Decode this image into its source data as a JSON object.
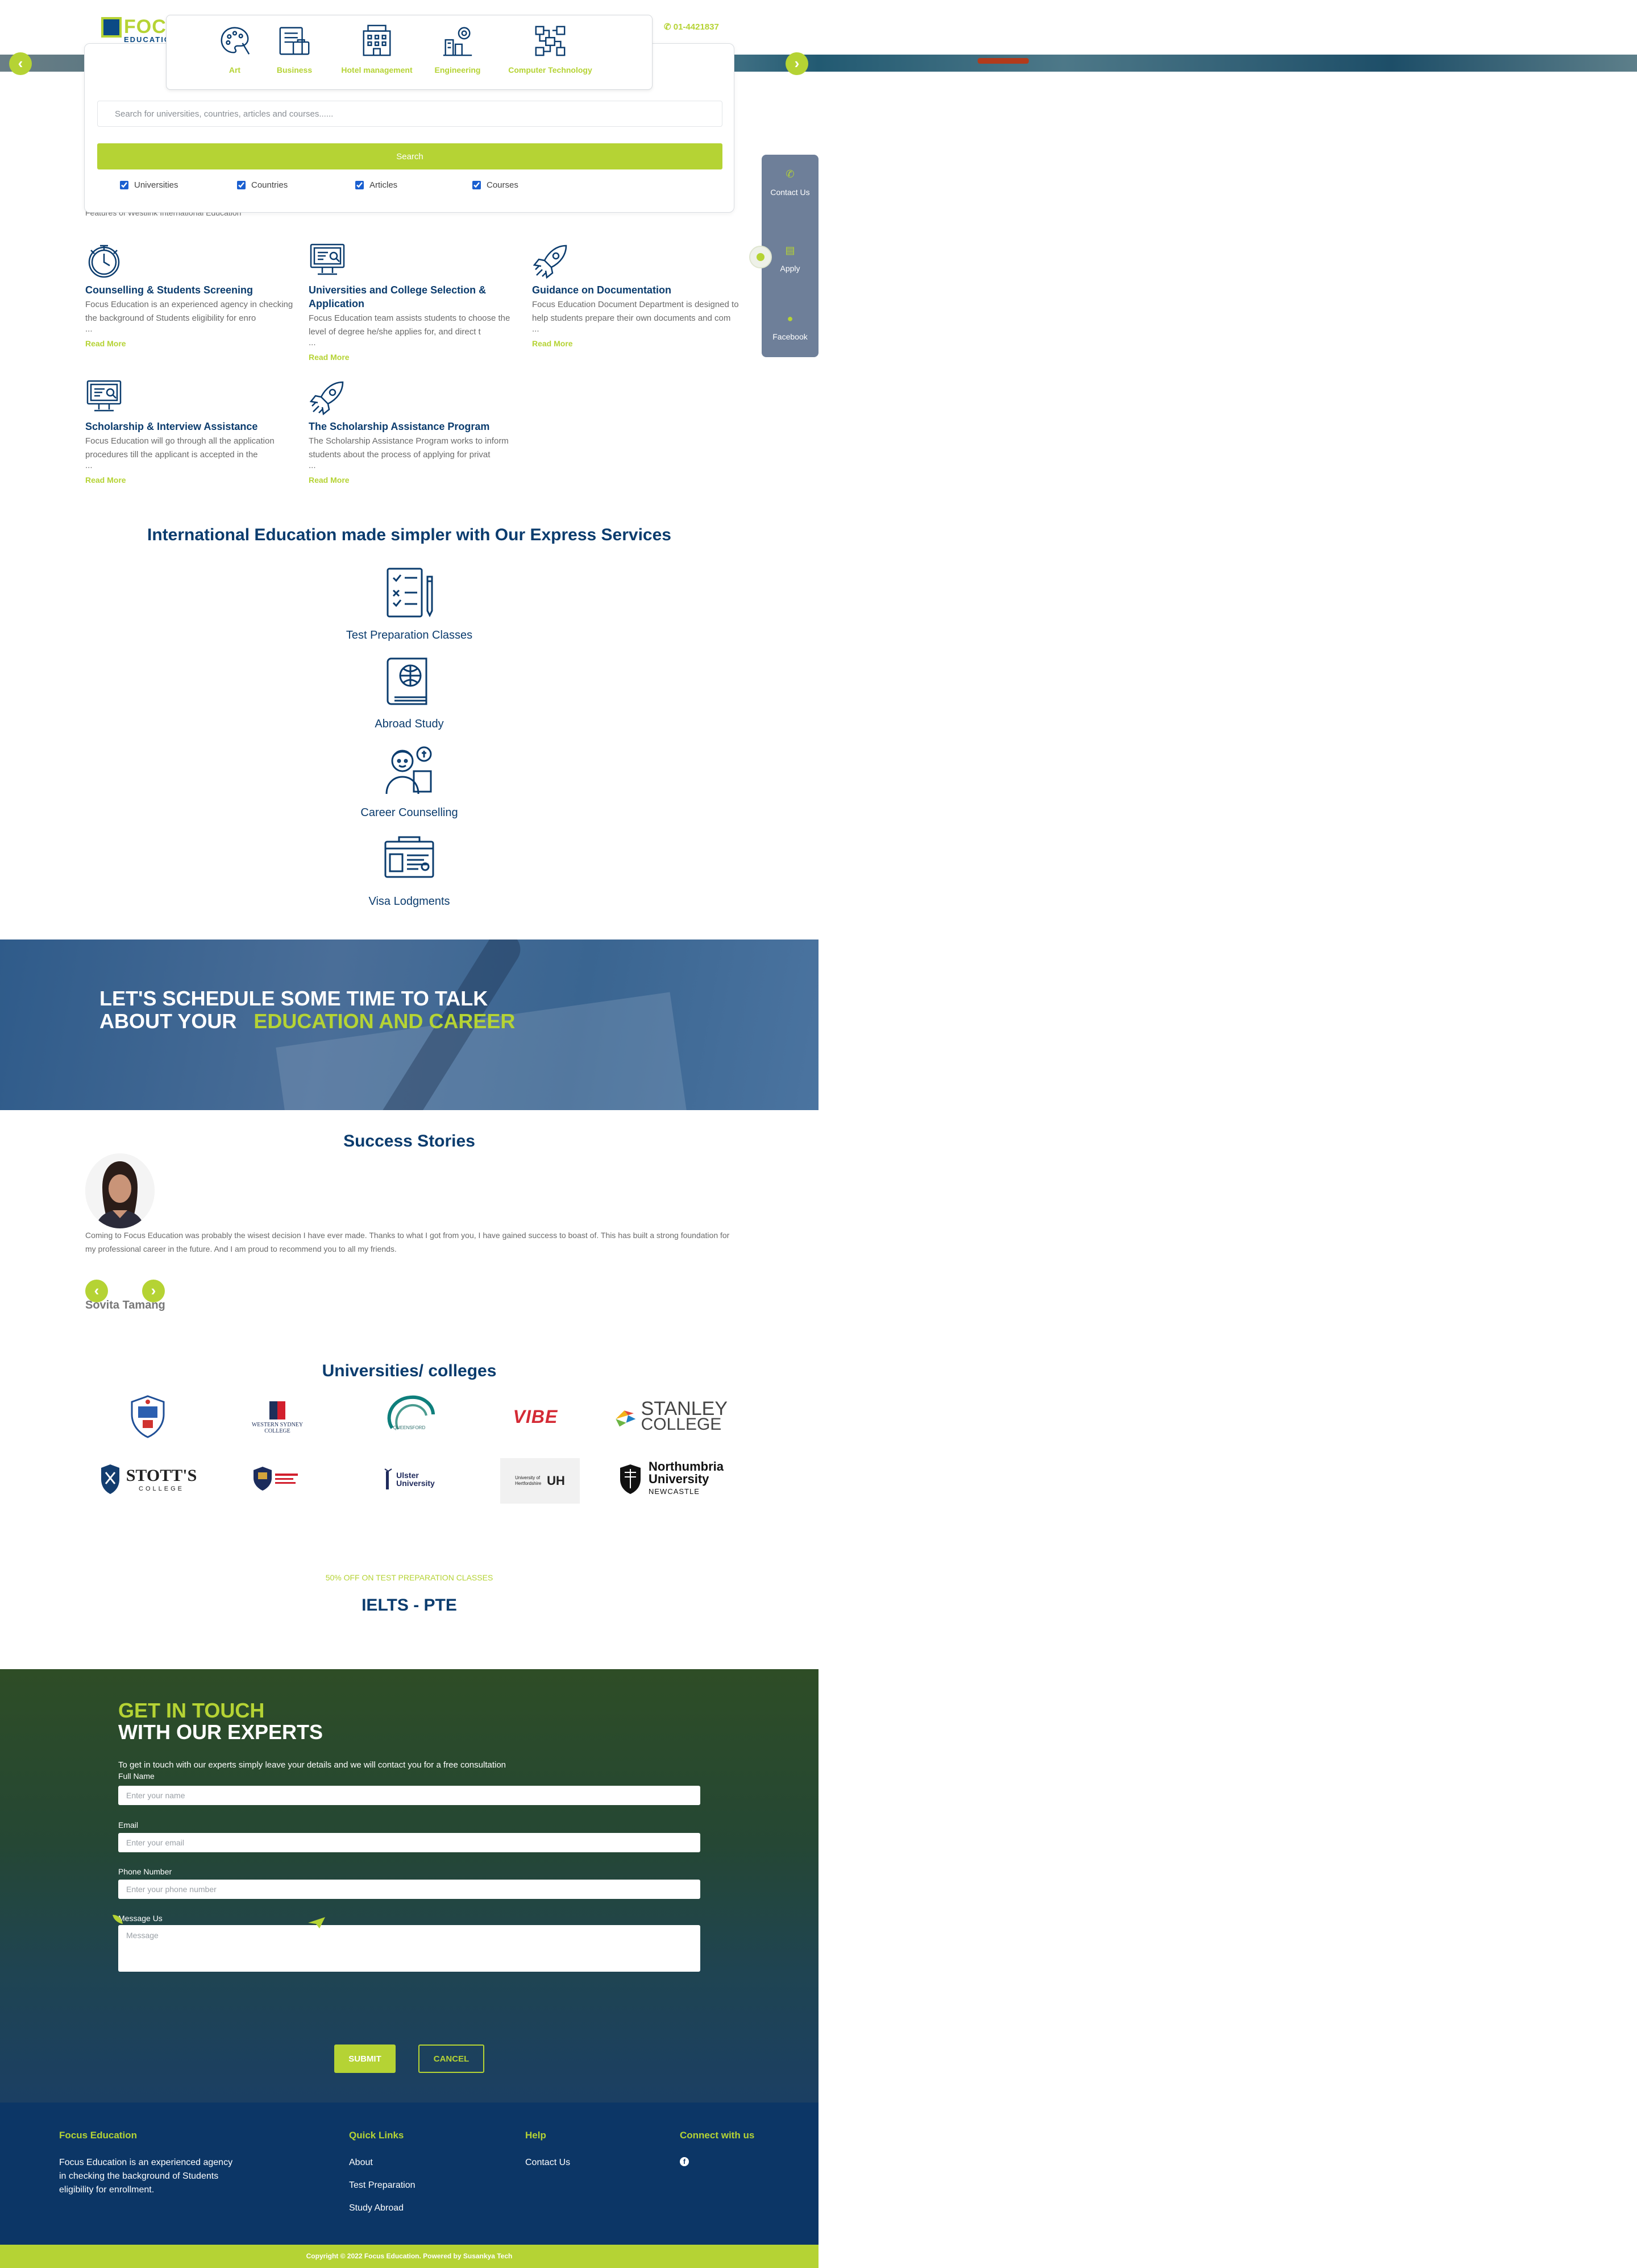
{
  "header": {
    "logo_text": "FOCUS",
    "logo_sub": "EDUCATION",
    "phone": "01-4421837"
  },
  "categories": [
    {
      "label": "Art",
      "icon": "palette-icon"
    },
    {
      "label": "Business",
      "icon": "briefcase-icon"
    },
    {
      "label": "Hotel management",
      "icon": "hotel-icon"
    },
    {
      "label": "Engineering",
      "icon": "engineering-icon"
    },
    {
      "label": "Computer Technology",
      "icon": "circuit-icon"
    }
  ],
  "search": {
    "placeholder": "Search for universities, countries, articles and courses......",
    "button": "Search",
    "filters": [
      "Universities",
      "Countries",
      "Articles",
      "Courses"
    ]
  },
  "side_widget": {
    "contact": "Contact Us",
    "apply": "Apply",
    "facebook": "Facebook"
  },
  "features": {
    "subtitle": "Features of Westlink International Education",
    "read_more": "Read More",
    "items": [
      {
        "title": "Counselling & Students Screening",
        "text": "Focus Education is an experienced agency in checking the background of Students eligibility for enro",
        "icon": "clock-icon"
      },
      {
        "title": "Universities and College Selection & Application",
        "text": "Focus Education team assists students to choose the level of degree he/she applies for, and direct t",
        "icon": "monitor-icon"
      },
      {
        "title": "Guidance on Documentation",
        "text": "Focus Education Document Department is designed to help students prepare their own documents and com",
        "icon": "rocket-icon"
      },
      {
        "title": "Scholarship & Interview Assistance",
        "text": "Focus Education will go through all the application procedures till the applicant is accepted in the",
        "icon": "monitor-icon"
      },
      {
        "title": "The Scholarship Assistance Program",
        "text": "The Scholarship Assistance Program works to inform students about the process of applying for privat",
        "icon": "rocket-icon"
      }
    ]
  },
  "express": {
    "title": "International Education made simpler with Our Express Services",
    "items": [
      {
        "label": "Test Preparation Classes",
        "icon": "checklist-icon"
      },
      {
        "label": "Abroad Study",
        "icon": "book-globe-icon"
      },
      {
        "label": "Career Counselling",
        "icon": "counsellor-icon"
      },
      {
        "label": "Visa Lodgments",
        "icon": "visa-board-icon"
      }
    ]
  },
  "schedule": {
    "line1": "LET'S SCHEDULE SOME TIME TO TALK",
    "line2": "ABOUT YOUR",
    "highlight": "EDUCATION AND CAREER"
  },
  "success": {
    "title": "Success Stories",
    "testimonial": "Coming to Focus Education was probably the wisest decision I have ever made. Thanks to what I got from you, I have gained success to boast of. This has built a strong foundation for my professional career in the future. And I am proud to recommend you to all my friends.",
    "name": "Sovita Tamang"
  },
  "universities": {
    "title": "Universities/ colleges",
    "logos": [
      {
        "name": "crest-logo"
      },
      {
        "name": "western-sydney-logo",
        "line1": "WESTERN SYDNEY",
        "line2": "COLLEGE"
      },
      {
        "name": "queensford-logo",
        "line1": "QUEENSFORD"
      },
      {
        "name": "vibe-logo",
        "line1": "VIBE"
      },
      {
        "name": "stanley-logo",
        "line1": "STANLEY",
        "line2": "COLLEGE"
      },
      {
        "name": "stotts-logo",
        "line1": "STOTT'S",
        "line2": "COLLEGE"
      },
      {
        "name": "sydney-crest-logo"
      },
      {
        "name": "ulster-logo",
        "line1": "Ulster",
        "line2": "University"
      },
      {
        "name": "herts-logo",
        "line1": "University of Hertfordshire",
        "line2": "UH"
      },
      {
        "name": "northumbria-logo",
        "line1": "Northumbria",
        "line2": "University",
        "line3": "NEWCASTLE"
      }
    ]
  },
  "promo": {
    "offer": "50% OFF ON TEST PREPARATION CLASSES",
    "title": "IELTS - PTE"
  },
  "contact": {
    "title1": "GET IN TOUCH",
    "title2": "WITH OUR EXPERTS",
    "desc": "To get in touch with our experts simply leave your details and we will contact you for a free consultation",
    "name_label": "Full Name",
    "name_placeholder": "Enter your name",
    "email_label": "Email",
    "email_placeholder": "Enter your email",
    "phone_label": "Phone Number",
    "phone_placeholder": "Enter your phone number",
    "message_label": "Message Us",
    "message_placeholder": "Message",
    "submit": "SUBMIT",
    "cancel": "CANCEL"
  },
  "footer": {
    "brand": "Focus Education",
    "brand_text": "Focus Education is an experienced agency in checking the background of Students eligibility for enrollment.",
    "quick_links_title": "Quick Links",
    "quick_links": [
      "About",
      "Test Preparation",
      "Study Abroad"
    ],
    "help_title": "Help",
    "help_links": [
      "Contact Us"
    ],
    "connect_title": "Connect with us",
    "copyright": "Copyright © 2022 Focus Education. Powered by Susankya Tech"
  },
  "colors": {
    "accent": "#b5d334",
    "navy": "#0b3c6e"
  }
}
